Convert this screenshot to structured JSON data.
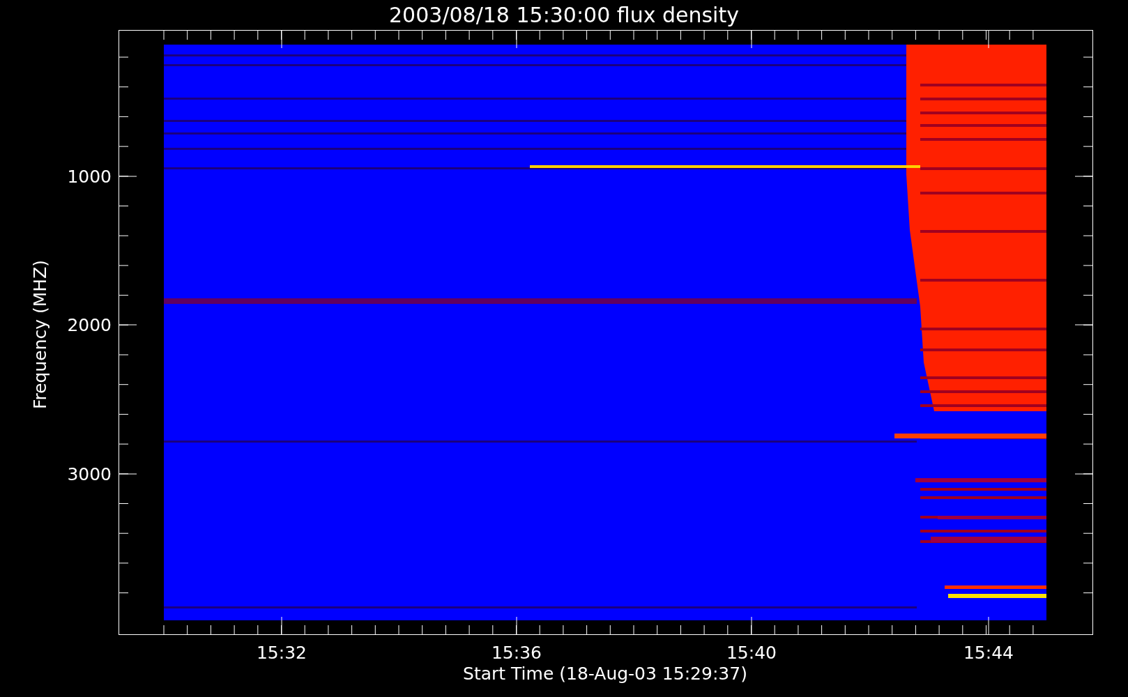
{
  "title": "2003/08/18 15:30:00 flux density",
  "y_axis": {
    "label": "Frequency (MHZ)",
    "ticks": [
      "1000",
      "2000",
      "3000"
    ]
  },
  "x_axis": {
    "label": "Start Time (18-Aug-03 15:29:37)",
    "ticks": [
      "15:32",
      "15:36",
      "15:40",
      "15:44"
    ]
  }
}
